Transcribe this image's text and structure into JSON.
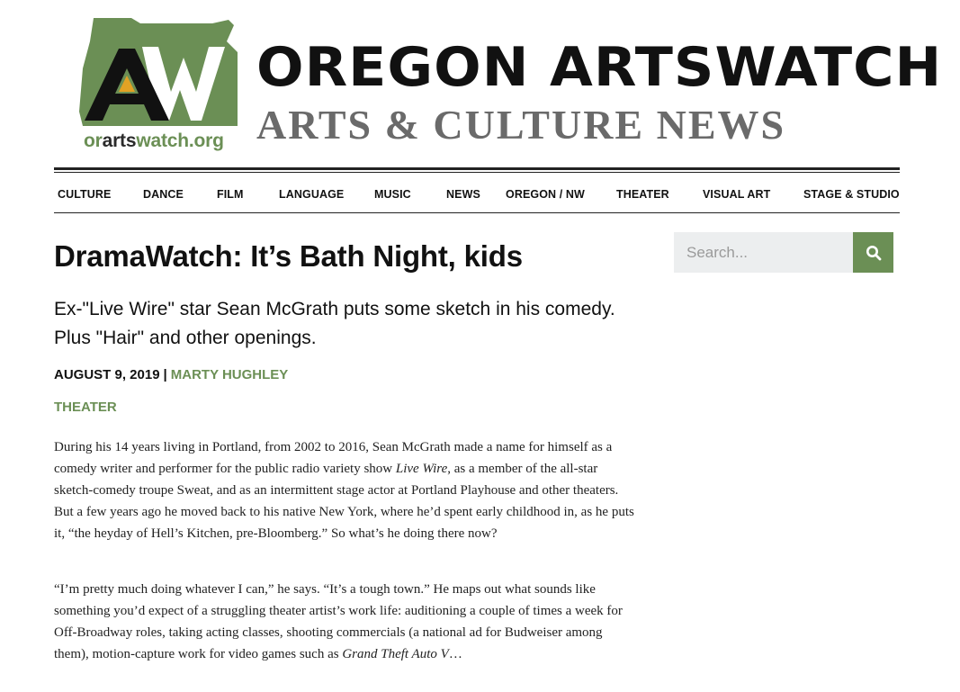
{
  "masthead": {
    "logo_url": "orartswatch.org",
    "logo_url_parts": [
      "or",
      "arts",
      "watch.org"
    ],
    "site_title": "OREGON ARTSWATCH",
    "tagline": "ARTS & CULTURE NEWS",
    "brand_green": "#6b8f55",
    "logo_icons": [
      "oregon-state-shape-icon",
      "a-letter-icon",
      "w-letter-icon"
    ]
  },
  "nav": {
    "items": [
      "CULTURE",
      "DANCE",
      "FILM",
      "LANGUAGE",
      "MUSIC",
      "NEWS",
      "OREGON / NW",
      "THEATER",
      "VISUAL ART",
      "STAGE & STUDIO"
    ]
  },
  "article": {
    "title": "DramaWatch: It’s Bath Night, kids",
    "subtitle": "Ex-\"Live Wire\" star Sean McGrath puts some sketch in his comedy. Plus \"Hair\" and other openings.",
    "date": "AUGUST 9, 2019",
    "separator": "|",
    "author": "MARTY HUGHLEY",
    "category": "THEATER",
    "paragraph1": {
      "before": "During his 14 years living in Portland, from 2002 to 2016, Sean McGrath made a name for himself as a comedy writer and performer for the public radio variety show ",
      "italic": "Live Wire",
      "after": ", as a member of the all-star sketch-comedy troupe Sweat, and as an intermittent stage actor at Portland Playhouse and other theaters. But a few years ago he moved back to his native New York, where he’d spent early childhood in, as he puts it, “the heyday of Hell’s Kitchen, pre-Bloomberg.” So what’s he doing there now?"
    },
    "paragraph2": {
      "before": "“I’m pretty much doing whatever I can,” he says. “It’s a tough town.” He maps out what sounds like something you’d expect of a struggling theater artist’s work life: auditioning a couple of times a week for Off-Broadway roles, taking acting classes, shooting commercials (a national ad for Budweiser among them), motion-capture work for video games such as ",
      "italic": "Grand Theft Auto V",
      "after": "…"
    }
  },
  "search": {
    "placeholder": "Search...",
    "button_icon": "search-icon"
  }
}
